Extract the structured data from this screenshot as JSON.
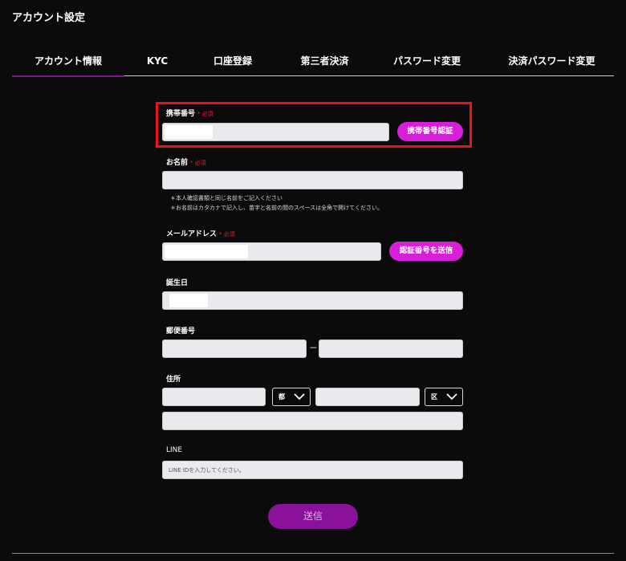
{
  "page_title": "アカウント設定",
  "tabs": [
    {
      "label": "アカウント情報",
      "active": true
    },
    {
      "label": "KYC"
    },
    {
      "label": "口座登録"
    },
    {
      "label": "第三者決済"
    },
    {
      "label": "パスワード変更"
    },
    {
      "label": "決済パスワード変更"
    }
  ],
  "required_mark": "* 必須",
  "form": {
    "phone": {
      "label": "携帯番号",
      "button": "携帯番号認証"
    },
    "name": {
      "label": "お名前",
      "notes": [
        "＊本人確認書類と同じ名前をご記入ください",
        "＊お名前はカタカナで記入し、苗字と名前の間のスペースは全角で開けてください。"
      ]
    },
    "email": {
      "label": "メールアドレス",
      "button": "認証番号を送信"
    },
    "birthday": {
      "label": "誕生日"
    },
    "postal": {
      "label": "郵便番号",
      "separator": "－"
    },
    "address": {
      "label": "住所",
      "prefecture_select": "都",
      "ward_select": "区"
    },
    "line": {
      "label": "LINE",
      "placeholder": "LINE IDを入力してください。"
    }
  },
  "submit_label": "送信",
  "colors": {
    "background": "#0b0b0b",
    "accent_pink": "#d91edb",
    "submit_purple": "#8a129b",
    "required_red": "#e4253a",
    "highlight_red": "#e8131b",
    "tab_underline": "#7a1a8c"
  }
}
